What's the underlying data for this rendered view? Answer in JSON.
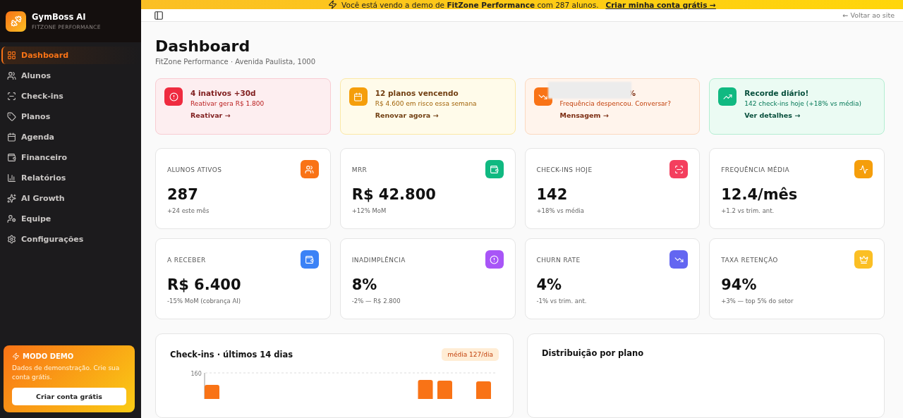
{
  "sidebar": {
    "brand": {
      "name": "GymBoss AI",
      "subtitle": "FITZONE PERFORMANCE"
    },
    "items": [
      {
        "label": "Dashboard",
        "selected": true
      },
      {
        "label": "Alunos",
        "selected": false
      },
      {
        "label": "Check-ins",
        "selected": false
      },
      {
        "label": "Planos",
        "selected": false
      },
      {
        "label": "Agenda",
        "selected": false
      },
      {
        "label": "Financeiro",
        "selected": false
      },
      {
        "label": "Relatórios",
        "selected": false
      },
      {
        "label": "AI Growth",
        "selected": false
      },
      {
        "label": "Equipe",
        "selected": false
      },
      {
        "label": "Configurações",
        "selected": false
      }
    ],
    "demo_card": {
      "title": "MODO DEMO",
      "text": "Dados de demonstração. Crie sua conta grátis.",
      "button": "Criar conta grátis"
    }
  },
  "banner": {
    "text": "Você está vendo a demo de **FitZone Performance** com 287 alunos.",
    "link": "Criar minha conta grátis →"
  },
  "topbar": {
    "back_link": "← Voltar ao site"
  },
  "page": {
    "title": "Dashboard",
    "subtitle": "FitZone Performance · Avenida Paulista, 1000"
  },
  "alerts": [
    {
      "kind": "danger",
      "title": "4 inativos +30d",
      "text": "Reativar gera R$ 1.800",
      "action": "Reativar →",
      "redacted": false
    },
    {
      "kind": "warning",
      "title": "12 planos vencendo",
      "text": "R$ 4.600 em risco essa semana",
      "action": "Renovar agora →",
      "redacted": false
    },
    {
      "kind": "drop",
      "title": "%",
      "text": "Frequência despencou. Conversar?",
      "action": "Mensagem →",
      "redacted": true
    },
    {
      "kind": "success",
      "title": "Recorde diário!",
      "text": "142 check-ins hoje (+18% vs média)",
      "action": "Ver detalhes →",
      "redacted": false
    }
  ],
  "kpis": [
    {
      "label": "ALUNOS ATIVOS",
      "value": "287",
      "note": "+24 este mês",
      "color": "#f97316"
    },
    {
      "label": "MRR",
      "value": "R$ 42.800",
      "note": "+12% MoM",
      "color": "#10b981"
    },
    {
      "label": "CHECK-INS HOJE",
      "value": "142",
      "note": "+18% vs média",
      "color": "#f43f5e"
    },
    {
      "label": "FREQUÊNCIA MÉDIA",
      "value": "12.4/mês",
      "note": "+1.2 vs trim. ant.",
      "color": "#f59e0b"
    },
    {
      "label": "A RECEBER",
      "value": "R$ 6.400",
      "note": "-15% MoM (cobrança AI)",
      "color": "#3b82f6"
    },
    {
      "label": "INADIMPLÊNCIA",
      "value": "8%",
      "note": "-2% — R$ 2.800",
      "color": "#a855f7"
    },
    {
      "label": "CHURN RATE",
      "value": "4%",
      "note": "-1% vs trim. ant.",
      "color": "#6366f1"
    },
    {
      "label": "TAXA RETENÇÃO",
      "value": "94%",
      "note": "+3% — top 5% do setor",
      "color": "#fbbf24"
    }
  ],
  "checkins_panel": {
    "title": "Check-ins · últimos 14 dias",
    "badge": "média 127/dia",
    "axis_label": "160"
  },
  "plans_panel": {
    "title": "Distribuição por plano"
  }
}
